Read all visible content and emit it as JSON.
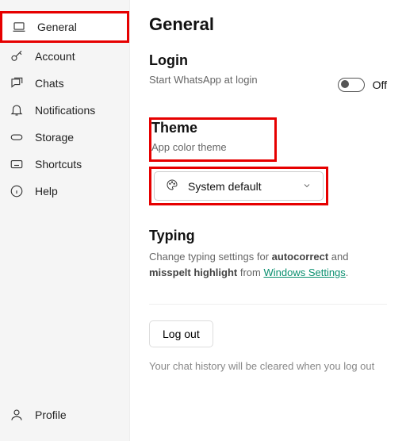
{
  "sidebar": {
    "items": [
      {
        "label": "General"
      },
      {
        "label": "Account"
      },
      {
        "label": "Chats"
      },
      {
        "label": "Notifications"
      },
      {
        "label": "Storage"
      },
      {
        "label": "Shortcuts"
      },
      {
        "label": "Help"
      }
    ],
    "profile": {
      "label": "Profile"
    }
  },
  "main": {
    "title": "General",
    "login": {
      "heading": "Login",
      "subtitle": "Start WhatsApp at login",
      "toggle_state": "Off"
    },
    "theme": {
      "heading": "Theme",
      "subtitle": "App color theme",
      "selected": "System default"
    },
    "typing": {
      "heading": "Typing",
      "prefix": "Change typing settings for ",
      "autocorrect": "autocorrect",
      "mid": " and ",
      "misspelt": "misspelt highlight",
      "from": " from ",
      "link": "Windows Settings",
      "suffix": "."
    },
    "logout": {
      "button": "Log out",
      "note": "Your chat history will be cleared when you log out"
    }
  }
}
